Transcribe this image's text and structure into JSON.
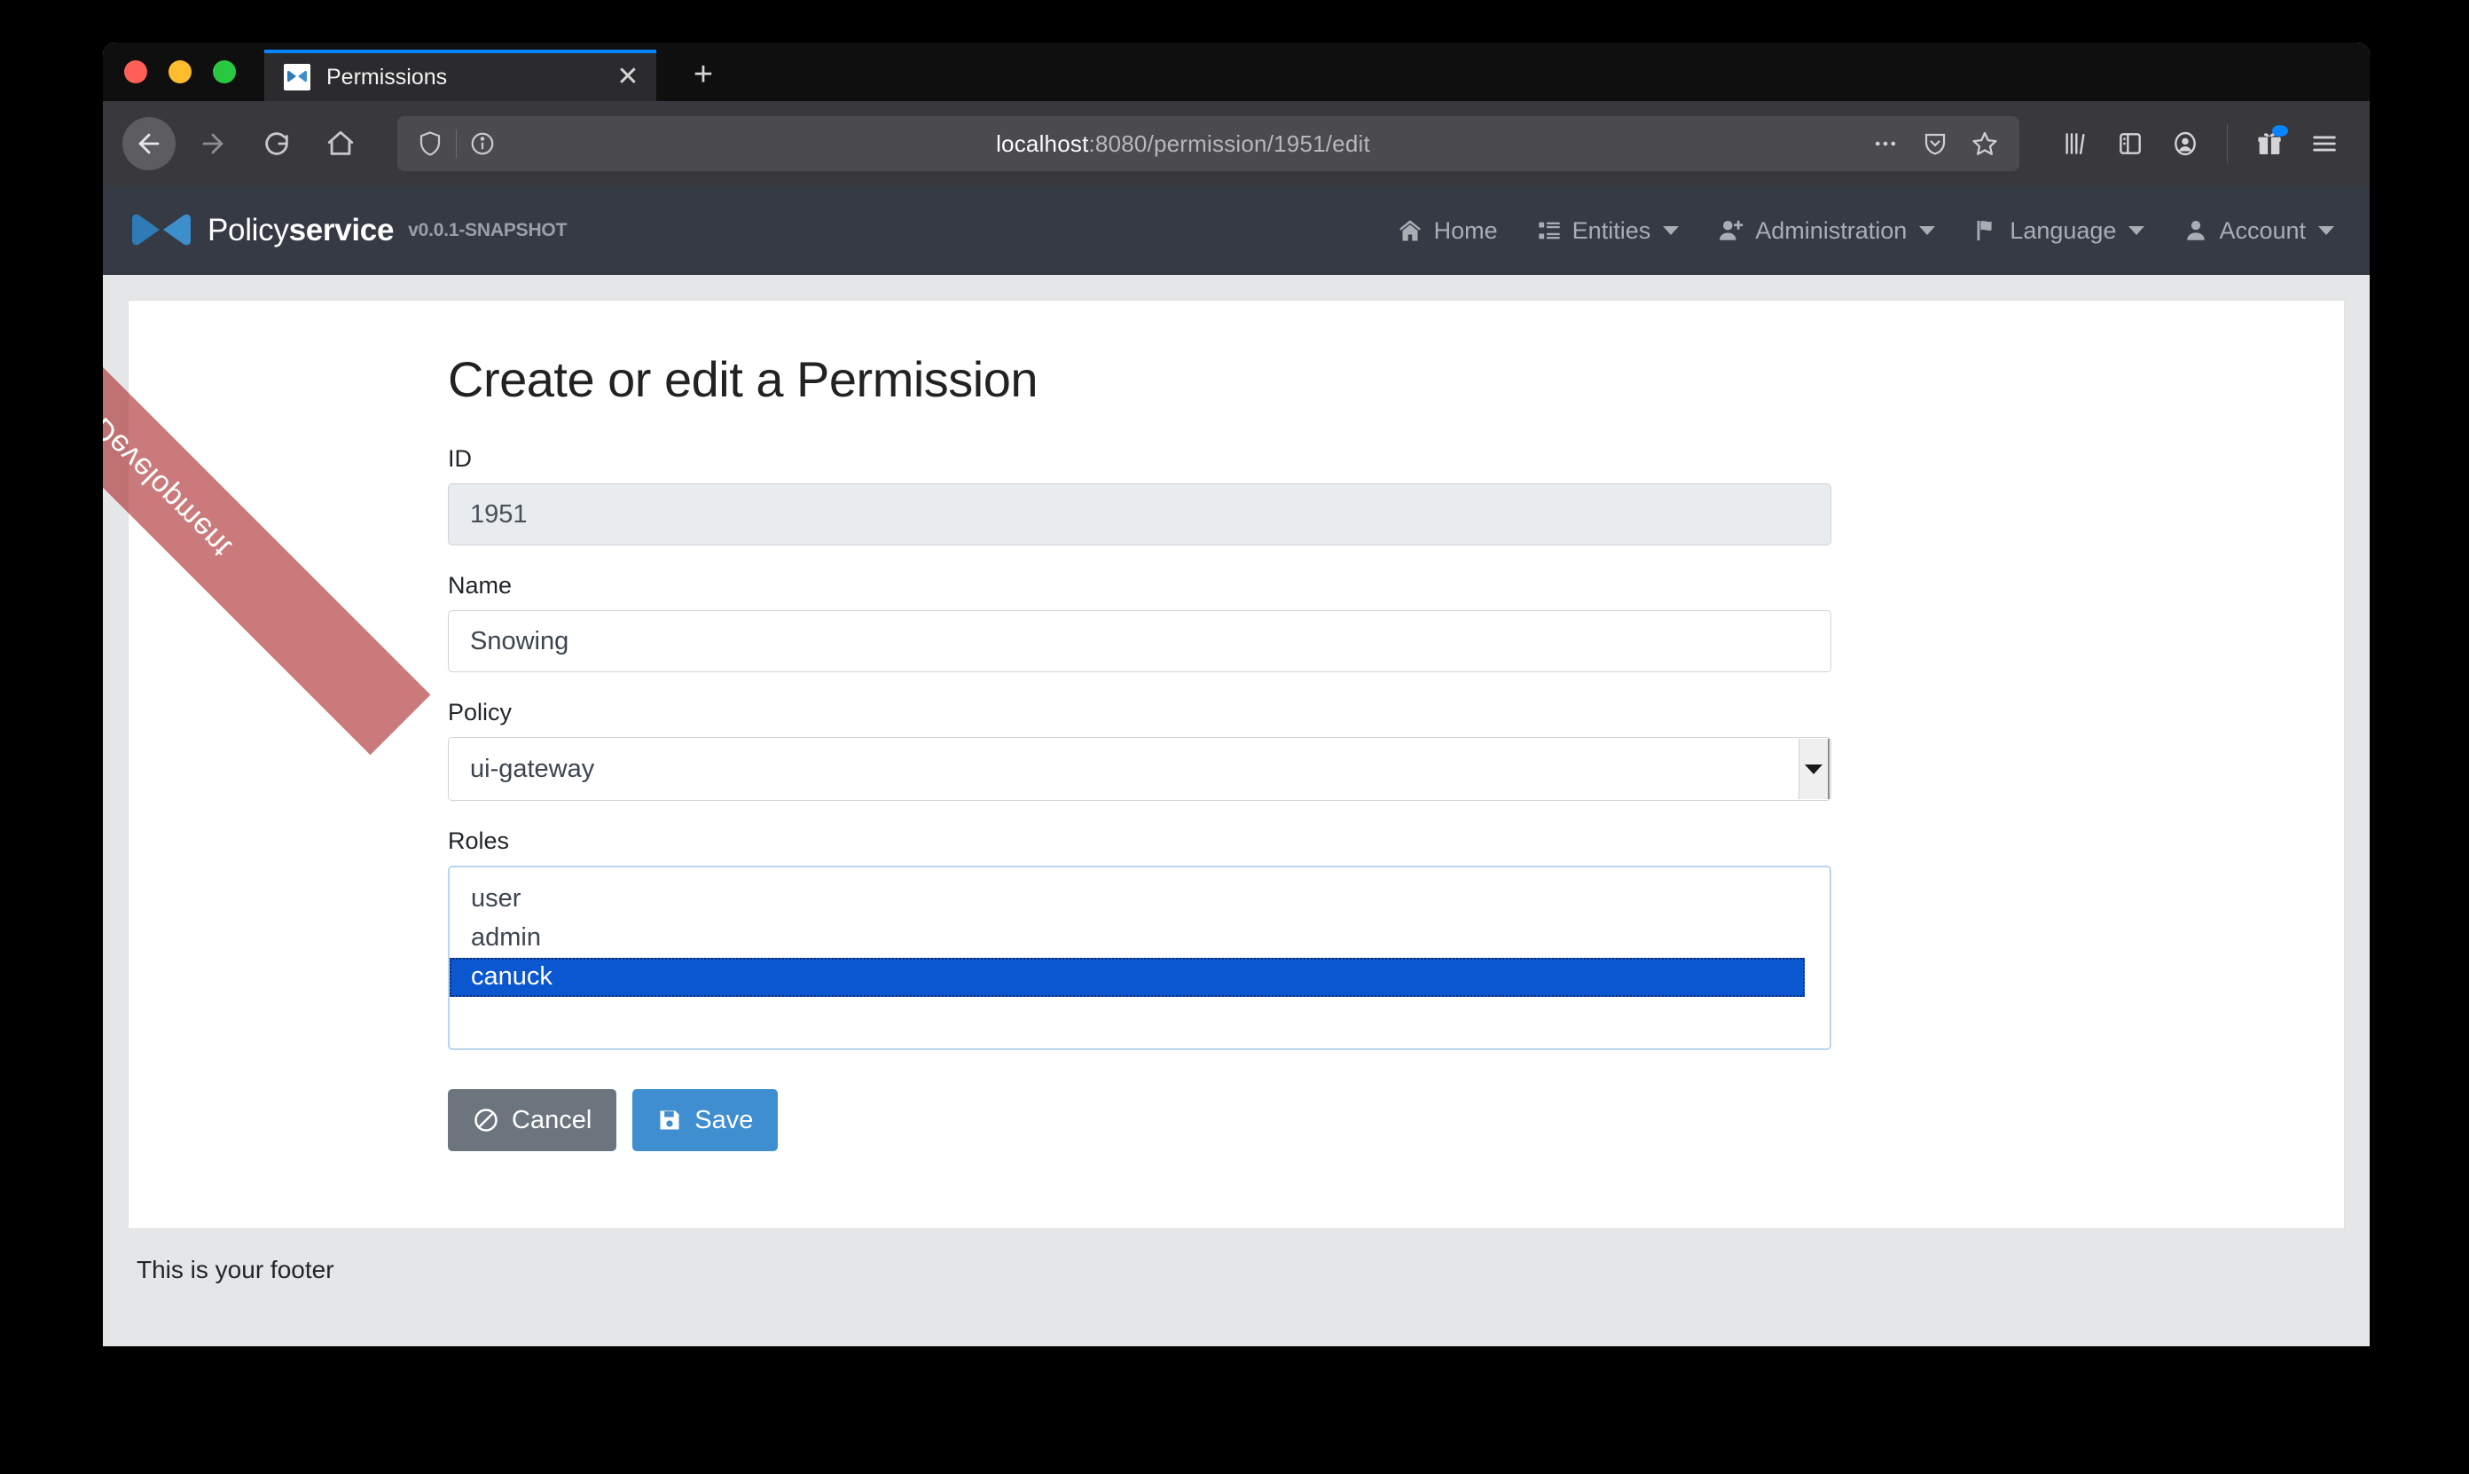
{
  "browser": {
    "tab": {
      "title": "Permissions",
      "favicon_icon": "bowtie-favicon",
      "close_icon": "close-icon"
    },
    "new_tab_icon": "plus-icon",
    "nav": {
      "back_icon": "back-arrow-icon",
      "forward_icon": "forward-arrow-icon",
      "reload_icon": "reload-icon",
      "home_icon": "home-icon"
    },
    "url": {
      "shield_icon": "shield-icon",
      "info_icon": "info-circle-icon",
      "host": "localhost",
      "path": ":8080/permission/1951/edit",
      "full": "localhost:8080/permission/1951/edit",
      "page_actions_icon": "ellipsis-icon",
      "pocket_icon": "pocket-icon",
      "bookmark_icon": "star-icon"
    },
    "toolbar_icons": [
      "library-icon",
      "sidebar-icon",
      "account-circle-icon",
      "gift-icon",
      "hamburger-menu-icon"
    ]
  },
  "ribbon": {
    "label": "Development",
    "color": "#aa2828"
  },
  "appnav": {
    "brand": {
      "name_light": "Policy",
      "name_bold": "service",
      "version": "v0.0.1-SNAPSHOT",
      "logo_icon": "bowtie-logo-icon"
    },
    "items": [
      {
        "label": "Home",
        "icon": "house-icon",
        "caret": false
      },
      {
        "label": "Entities",
        "icon": "list-grid-icon",
        "caret": true
      },
      {
        "label": "Administration",
        "icon": "user-plus-icon",
        "caret": true
      },
      {
        "label": "Language",
        "icon": "flag-icon",
        "caret": true
      },
      {
        "label": "Account",
        "icon": "user-icon",
        "caret": true
      }
    ]
  },
  "form": {
    "title": "Create or edit a Permission",
    "id": {
      "label": "ID",
      "value": "1951",
      "disabled": true
    },
    "name": {
      "label": "Name",
      "value": "Snowing",
      "placeholder": ""
    },
    "policy": {
      "label": "Policy",
      "value": "ui-gateway"
    },
    "roles": {
      "label": "Roles",
      "options": [
        {
          "label": "user",
          "selected": false
        },
        {
          "label": "admin",
          "selected": false
        },
        {
          "label": "canuck",
          "selected": true
        }
      ]
    },
    "buttons": {
      "cancel": {
        "label": "Cancel",
        "icon": "ban-icon"
      },
      "save": {
        "label": "Save",
        "icon": "floppy-disk-icon"
      }
    }
  },
  "footer": {
    "text": "This is your footer"
  },
  "colors": {
    "navbar_bg": "#353a44",
    "primary": "#3e8ed0",
    "secondary": "#6c757d",
    "selection": "#0b57d0",
    "body_bg": "#e4e6e8"
  }
}
